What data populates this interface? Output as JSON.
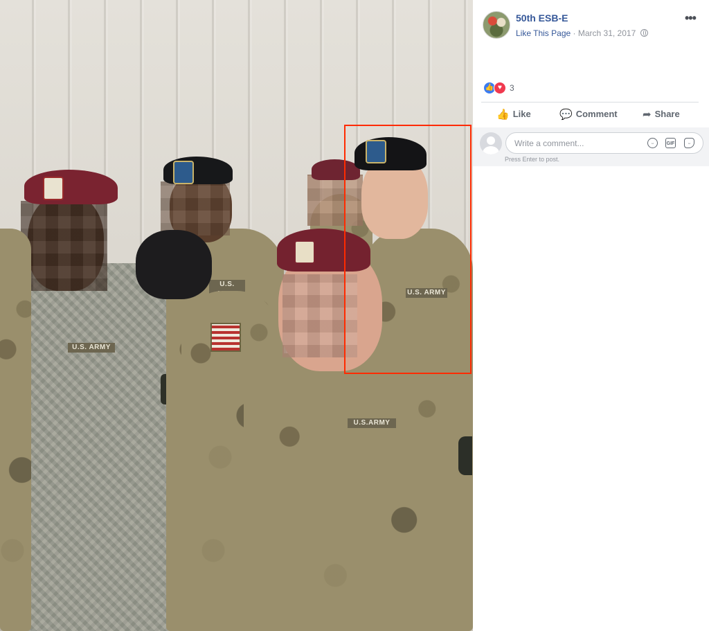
{
  "post": {
    "page_name": "50th ESB-E",
    "like_page": "Like This Page",
    "separator": "·",
    "date": "March 31, 2017",
    "more_icon": "more-options-icon",
    "privacy_icon": "globe-icon"
  },
  "reactions": {
    "icons": [
      "like-reaction-icon",
      "love-reaction-icon"
    ],
    "count": "3"
  },
  "actions": {
    "like": "Like",
    "comment": "Comment",
    "share": "Share"
  },
  "comment_box": {
    "placeholder": "Write a comment...",
    "hint": "Press Enter to post.",
    "gif_label": "GIF"
  },
  "photo": {
    "tape_texts": [
      "U.S. ARMY",
      "U.S. ARMY",
      "U.S. ARMY",
      "U.S.ARMY"
    ],
    "highlight_color": "#ff2a00"
  },
  "colors": {
    "link": "#365899",
    "meta": "#90949c",
    "action": "#606770"
  }
}
